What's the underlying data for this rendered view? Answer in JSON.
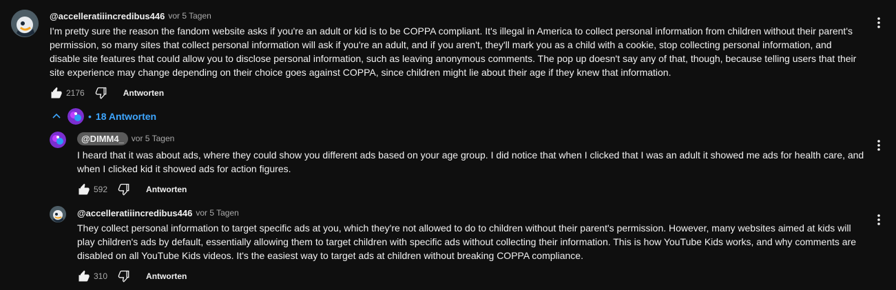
{
  "comments": [
    {
      "author": "@accelleratiiincredibus446",
      "time": "vor 5 Tagen",
      "text": "I'm pretty sure the reason the fandom website asks if you're an adult or kid is to be COPPA compliant. It's illegal in America to collect personal information from children without their parent's permission, so many sites that collect personal information will ask if you're an adult, and if you aren't, they'll mark you as a child with a cookie, stop collecting personal information, and disable site features that could allow you to disclose personal information, such as leaving anonymous comments. The pop up doesn't say any of that, though, because telling users that their site experience may change depending on their choice goes against COPPA, since children might lie about their age if they knew that information.",
      "likes": "2176",
      "reply_label": "Antworten"
    }
  ],
  "replies_toggle": {
    "label": "18 Antworten",
    "dot": "•"
  },
  "replies": [
    {
      "author": "@DIMM4_",
      "time": "vor 5 Tagen",
      "text": "I heard that it was about ads, where they could show you different ads based on your age group. I did notice that when I clicked that I was an adult it showed me ads for health care, and when I clicked kid it showed ads for action figures.",
      "likes": "592",
      "reply_label": "Antworten"
    },
    {
      "author": "@accelleratiiincredibus446",
      "time": "vor 5 Tagen",
      "text": "They collect personal information to target specific ads at you, which they're not allowed to do to children without their parent's permission. However, many websites aimed at kids will play children's ads by default, essentially allowing them to target children with specific ads without collecting their information. This is how YouTube Kids works, and why comments are disabled on all YouTube Kids videos. It's the easiest way to target ads at children without breaking COPPA compliance.",
      "likes": "310",
      "reply_label": "Antworten"
    }
  ],
  "colors": {
    "background": "#0f0f0f",
    "text": "#f1f1f1",
    "secondary": "#aaaaaa",
    "link": "#3ea6ff",
    "chip": "#5a5a5a"
  }
}
